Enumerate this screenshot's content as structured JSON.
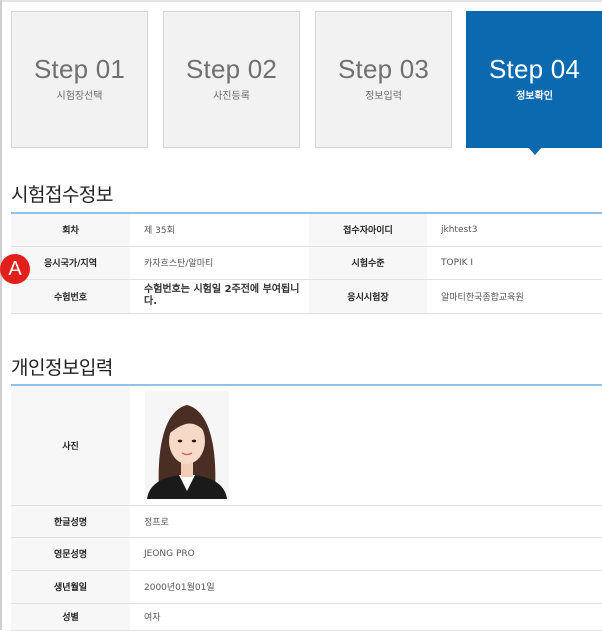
{
  "steps": [
    {
      "num": "Step 01",
      "label": "시험장선택",
      "active": false
    },
    {
      "num": "Step 02",
      "label": "사진등록",
      "active": false
    },
    {
      "num": "Step 03",
      "label": "정보입력",
      "active": false
    },
    {
      "num": "Step 04",
      "label": "정보확인",
      "active": true
    }
  ],
  "exam_section": {
    "title": "시험접수정보",
    "rows": [
      {
        "h1": "회차",
        "v1": "제 35회",
        "h2": "접수자아이디",
        "v2": "jkhtest3"
      },
      {
        "h1": "응시국가/지역",
        "v1": "카자흐스탄/알마티",
        "h2": "시험수준",
        "v2": "TOPIK Ⅰ"
      },
      {
        "h1": "수험번호",
        "v1": "수험번호는 시험일 2주전에 부여됩니다.",
        "h2": "응시시험장",
        "v2": "알마티한국종합교육원"
      }
    ]
  },
  "marker": {
    "label": "A",
    "color": "#e1201b"
  },
  "personal_section": {
    "title": "개인정보입력",
    "photo_label": "사진",
    "rows": [
      {
        "h": "한글성명",
        "v": "정프로"
      },
      {
        "h": "영문성명",
        "v": "JEONG PRO"
      },
      {
        "h": "생년월일",
        "v": "2000년01월01일"
      },
      {
        "h": "성별",
        "v": "여자"
      }
    ]
  },
  "colors": {
    "accent": "#0b69b0",
    "rule": "#8fc2e6",
    "marker": "#e1201b"
  }
}
